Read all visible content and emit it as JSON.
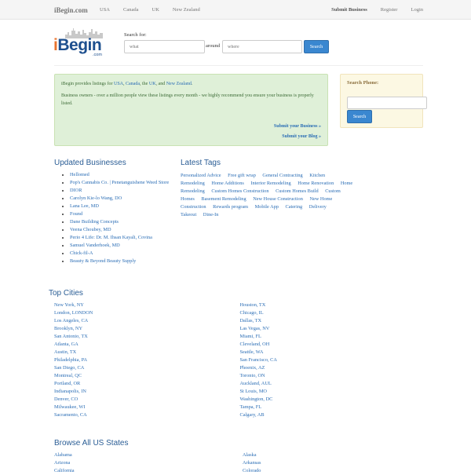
{
  "nav": {
    "brand": "iBegin.com",
    "left": [
      "USA",
      "Canada",
      "UK",
      "New Zealand"
    ],
    "right": [
      "Submit Business",
      "Register",
      "Login"
    ]
  },
  "header": {
    "logo_main": "Begin",
    "logo_i": "i",
    "logo_com": ".com",
    "search_label": "Search for:",
    "what_placeholder": "what",
    "around_label": "around",
    "where_placeholder": "where",
    "search_button": "Search"
  },
  "info": {
    "line1_pre": "iBegin provides listings for ",
    "usa": "USA",
    "comma1": ", ",
    "canada": "Canada",
    "the": ", the ",
    "uk": "UK",
    "and": ", and ",
    "nz": "New Zealand",
    "period": ".",
    "line2": "Business owners - over a million people view these listings every month - we highly recommend you ensure your business is properly listed.",
    "submit_business": "Submit your Business »",
    "submit_blog": "Submit your Blog »"
  },
  "phone": {
    "label": "Search Phone:",
    "button": "Search"
  },
  "updated": {
    "title": "Updated Businesses",
    "items": [
      "Hellomed",
      "Pop's Cannabis Co. | Penetanguishene Weed Store",
      "DIOR",
      "Carolyn Kie-lo Wang, DO",
      "Lana Lee, MD",
      "Found",
      "Dane Building Concepts",
      "Veena Choubey, MD",
      "Perio 4 Life: Dr. M. Ihsan Kayali, Covina",
      "Samuel Vanderhoek, MD",
      "Chick-fil-A",
      "Beauty & Beyond Beauty Supply"
    ]
  },
  "tags": {
    "title": "Latest Tags",
    "items": [
      "Personalized Advice",
      "Free gift wrap",
      "General Contracting",
      "Kitchen Remodeling",
      "Home Additions",
      "Interior Remodeling",
      "Home Renovation",
      "Home Remodeling",
      "Custom Homes Construction",
      "Custom Homes Build",
      "Custom Homes",
      "Basement Remodeling",
      "New House Construction",
      "New Home Construction",
      "Rewards program",
      "Mobile App",
      "Catering",
      "Delivery",
      "Takeout",
      "Dine-In"
    ]
  },
  "cities": {
    "title": "Top Cities",
    "left": [
      "New York, NY",
      "London, LONDON",
      "Los Angeles, CA",
      "Brooklyn, NY",
      "San Antonio, TX",
      "Atlanta, GA",
      "Austin, TX",
      "Philadelphia, PA",
      "San Diego, CA",
      "Montreal, QC",
      "Portland, OR",
      "Indianapolis, IN",
      "Denver, CO",
      "Milwaukee, WI",
      "Sacramento, CA"
    ],
    "right": [
      "Houston, TX",
      "Chicago, IL",
      "Dallas, TX",
      "Las Vegas, NV",
      "Miami, FL",
      "Cleveland, OH",
      "Seattle, WA",
      "San Francisco, CA",
      "Phoenix, AZ",
      "Toronto, ON",
      "Auckland, AUL",
      "St Louis, MO",
      "Washington, DC",
      "Tampa, FL",
      "Calgary, AB"
    ]
  },
  "states": {
    "title": "Browse All US States",
    "left": [
      "Alabama",
      "Arizona",
      "California"
    ],
    "right": [
      "Alaska",
      "Arkansas",
      "Colorado"
    ]
  },
  "colors": {
    "accent": "#3a87d0",
    "link": "#2a6db5",
    "success_bg": "#dff0d8",
    "warning_bg": "#fcf8e3"
  }
}
